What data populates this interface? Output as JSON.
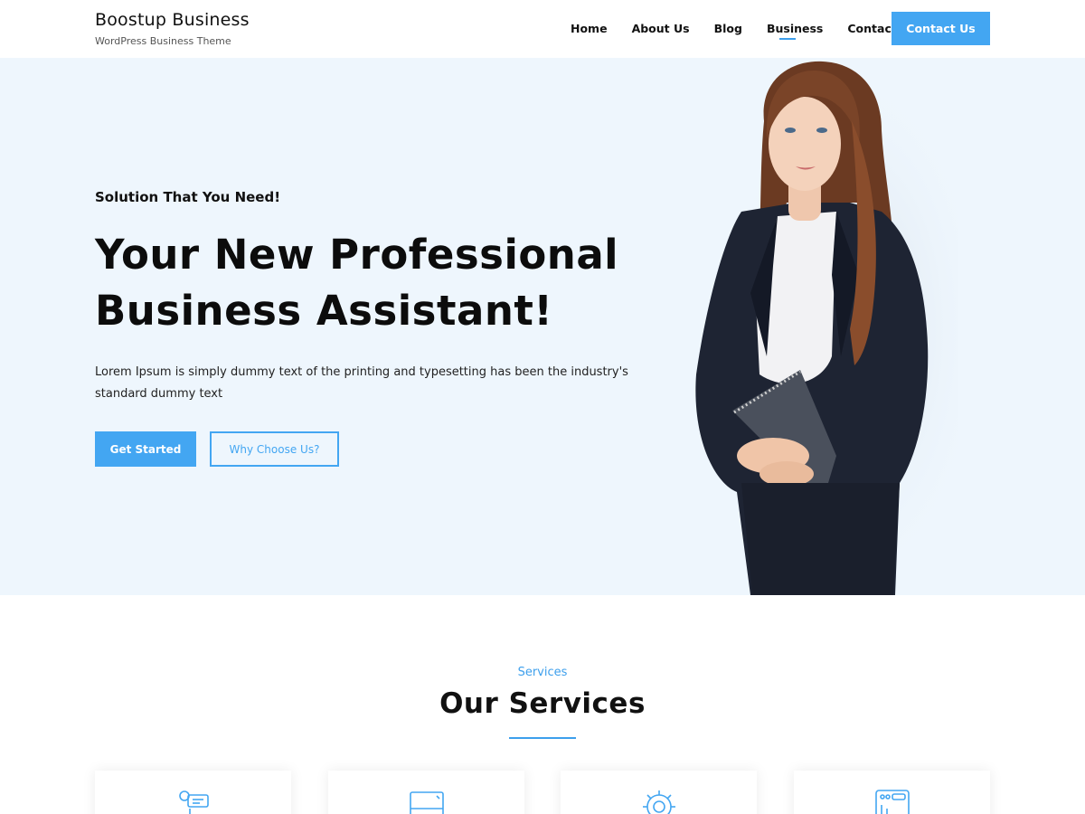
{
  "header": {
    "brand_title": "Boostup Business",
    "brand_tagline": "WordPress Business Theme",
    "nav": [
      {
        "label": "Home"
      },
      {
        "label": "About Us"
      },
      {
        "label": "Blog"
      },
      {
        "label": "Business",
        "active": true
      },
      {
        "label": "Contact"
      }
    ],
    "contact_button": "Contact Us"
  },
  "hero": {
    "subtitle": "Solution That You Need!",
    "title_line1": "Your New Professional",
    "title_line2": "Business Assistant!",
    "description": "Lorem Ipsum is simply dummy text of the printing and typesetting has been the industry's standard dummy text",
    "primary_button": "Get Started",
    "secondary_button": "Why Choose Us?"
  },
  "services": {
    "eyebrow": "Services",
    "title": "Our Services",
    "cards": [
      {
        "icon": "chat-support-icon"
      },
      {
        "icon": "monitor-icon"
      },
      {
        "icon": "gear-icon"
      },
      {
        "icon": "dashboard-icon"
      }
    ]
  },
  "colors": {
    "accent": "#43a6f2",
    "hero_bg": "#eef6fd",
    "text": "#111111"
  }
}
